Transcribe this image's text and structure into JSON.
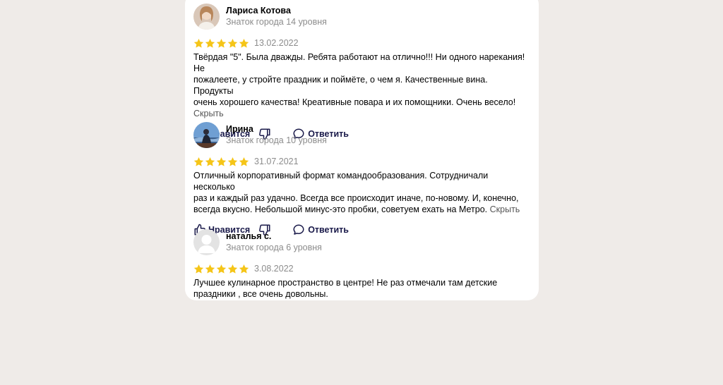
{
  "colors": {
    "page_bg": "#efebe8",
    "card_bg": "#ffffff",
    "star": "#f5c518",
    "muted": "#8c8c8c",
    "action": "#1a1a4a"
  },
  "labels": {
    "like": "Нравится",
    "reply": "Ответить",
    "hide": "Скрыть"
  },
  "reviews": [
    {
      "author": "Лариса Котова",
      "level": "Знаток города 14 уровня",
      "rating": 5,
      "date": "13.02.2022",
      "lines": [
        "Твёрдая \"5\". Была дважды. Ребята работают на отлично!!! Ни одного нарекания! Не",
        "пожалеете, у стройте праздник и поймёте, о чем я. Качественные вина. Продукты",
        "очень хорошего качества! Креативные повара и их помощники. Очень весело!"
      ],
      "hide": "Скрыть"
    },
    {
      "author": "Ирина",
      "level": "Знаток города 10 уровня",
      "rating": 5,
      "date": "31.07.2021",
      "lines": [
        "Отличный корпоративный формат командообразования. Сотрудничали несколько",
        "раз и каждый раз удачно. Всегда все происходит иначе, по-новому. И, конечно,",
        "всегда вкусно. Небольшой минус-это пробки, советуем ехать на Метро."
      ],
      "hide": "Скрыть"
    },
    {
      "author": "наталья с.",
      "level": "Знаток города 6 уровня",
      "rating": 5,
      "date": "3.08.2022",
      "lines": [
        "Лучшее кулинарное пространство в центре! Не раз отмечали там детские",
        "праздники , все очень довольны."
      ]
    }
  ]
}
